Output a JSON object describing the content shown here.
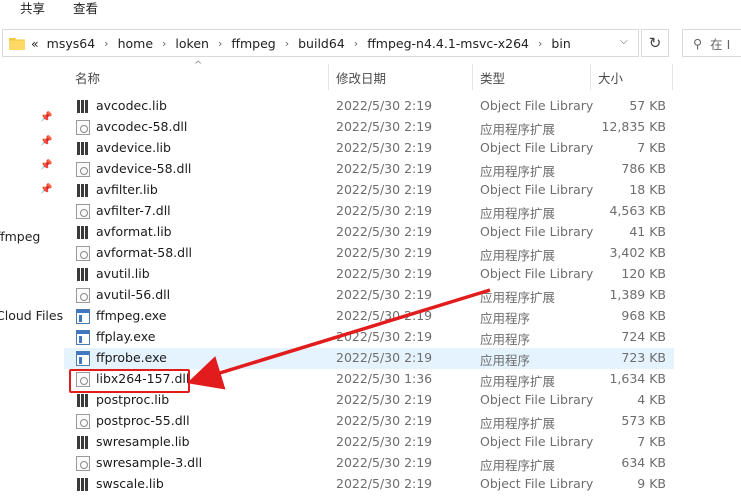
{
  "ribbon": {
    "tabs": [
      "共享",
      "查看"
    ]
  },
  "address": {
    "overflow": "«",
    "crumbs": [
      "msys64",
      "home",
      "loken",
      "ffmpeg",
      "build64",
      "ffmpeg-n4.4.1-msvc-x264",
      "bin"
    ],
    "search_placeholder": "在 I"
  },
  "nav": {
    "items": [
      "ffmpeg",
      "Cloud Files"
    ]
  },
  "columns": {
    "name": "名称",
    "date": "修改日期",
    "type": "类型",
    "size": "大小"
  },
  "files": [
    {
      "name": "avcodec.lib",
      "date": "2022/5/30 2:19",
      "type": "Object File Library",
      "size": "57 KB",
      "kind": "lib"
    },
    {
      "name": "avcodec-58.dll",
      "date": "2022/5/30 2:19",
      "type": "应用程序扩展",
      "size": "12,835 KB",
      "kind": "dll"
    },
    {
      "name": "avdevice.lib",
      "date": "2022/5/30 2:19",
      "type": "Object File Library",
      "size": "7 KB",
      "kind": "lib"
    },
    {
      "name": "avdevice-58.dll",
      "date": "2022/5/30 2:19",
      "type": "应用程序扩展",
      "size": "786 KB",
      "kind": "dll"
    },
    {
      "name": "avfilter.lib",
      "date": "2022/5/30 2:19",
      "type": "Object File Library",
      "size": "18 KB",
      "kind": "lib"
    },
    {
      "name": "avfilter-7.dll",
      "date": "2022/5/30 2:19",
      "type": "应用程序扩展",
      "size": "4,563 KB",
      "kind": "dll"
    },
    {
      "name": "avformat.lib",
      "date": "2022/5/30 2:19",
      "type": "Object File Library",
      "size": "41 KB",
      "kind": "lib"
    },
    {
      "name": "avformat-58.dll",
      "date": "2022/5/30 2:19",
      "type": "应用程序扩展",
      "size": "3,402 KB",
      "kind": "dll"
    },
    {
      "name": "avutil.lib",
      "date": "2022/5/30 2:19",
      "type": "Object File Library",
      "size": "120 KB",
      "kind": "lib"
    },
    {
      "name": "avutil-56.dll",
      "date": "2022/5/30 2:19",
      "type": "应用程序扩展",
      "size": "1,389 KB",
      "kind": "dll"
    },
    {
      "name": "ffmpeg.exe",
      "date": "2022/5/30 2:19",
      "type": "应用程序",
      "size": "968 KB",
      "kind": "exe"
    },
    {
      "name": "ffplay.exe",
      "date": "2022/5/30 2:19",
      "type": "应用程序",
      "size": "724 KB",
      "kind": "exe"
    },
    {
      "name": "ffprobe.exe",
      "date": "2022/5/30 2:19",
      "type": "应用程序",
      "size": "723 KB",
      "kind": "exe",
      "selected": true
    },
    {
      "name": "libx264-157.dll",
      "date": "2022/5/30 1:36",
      "type": "应用程序扩展",
      "size": "1,634 KB",
      "kind": "dll",
      "highlighted": true
    },
    {
      "name": "postproc.lib",
      "date": "2022/5/30 2:19",
      "type": "Object File Library",
      "size": "4 KB",
      "kind": "lib"
    },
    {
      "name": "postproc-55.dll",
      "date": "2022/5/30 2:19",
      "type": "应用程序扩展",
      "size": "573 KB",
      "kind": "dll"
    },
    {
      "name": "swresample.lib",
      "date": "2022/5/30 2:19",
      "type": "Object File Library",
      "size": "7 KB",
      "kind": "lib"
    },
    {
      "name": "swresample-3.dll",
      "date": "2022/5/30 2:19",
      "type": "应用程序扩展",
      "size": "634 KB",
      "kind": "dll"
    },
    {
      "name": "swscale.lib",
      "date": "2022/5/30 2:19",
      "type": "Object File Library",
      "size": "9 KB",
      "kind": "lib"
    }
  ],
  "colors": {
    "selection": "#e5f3ff",
    "annotation": "#e21c1c"
  }
}
